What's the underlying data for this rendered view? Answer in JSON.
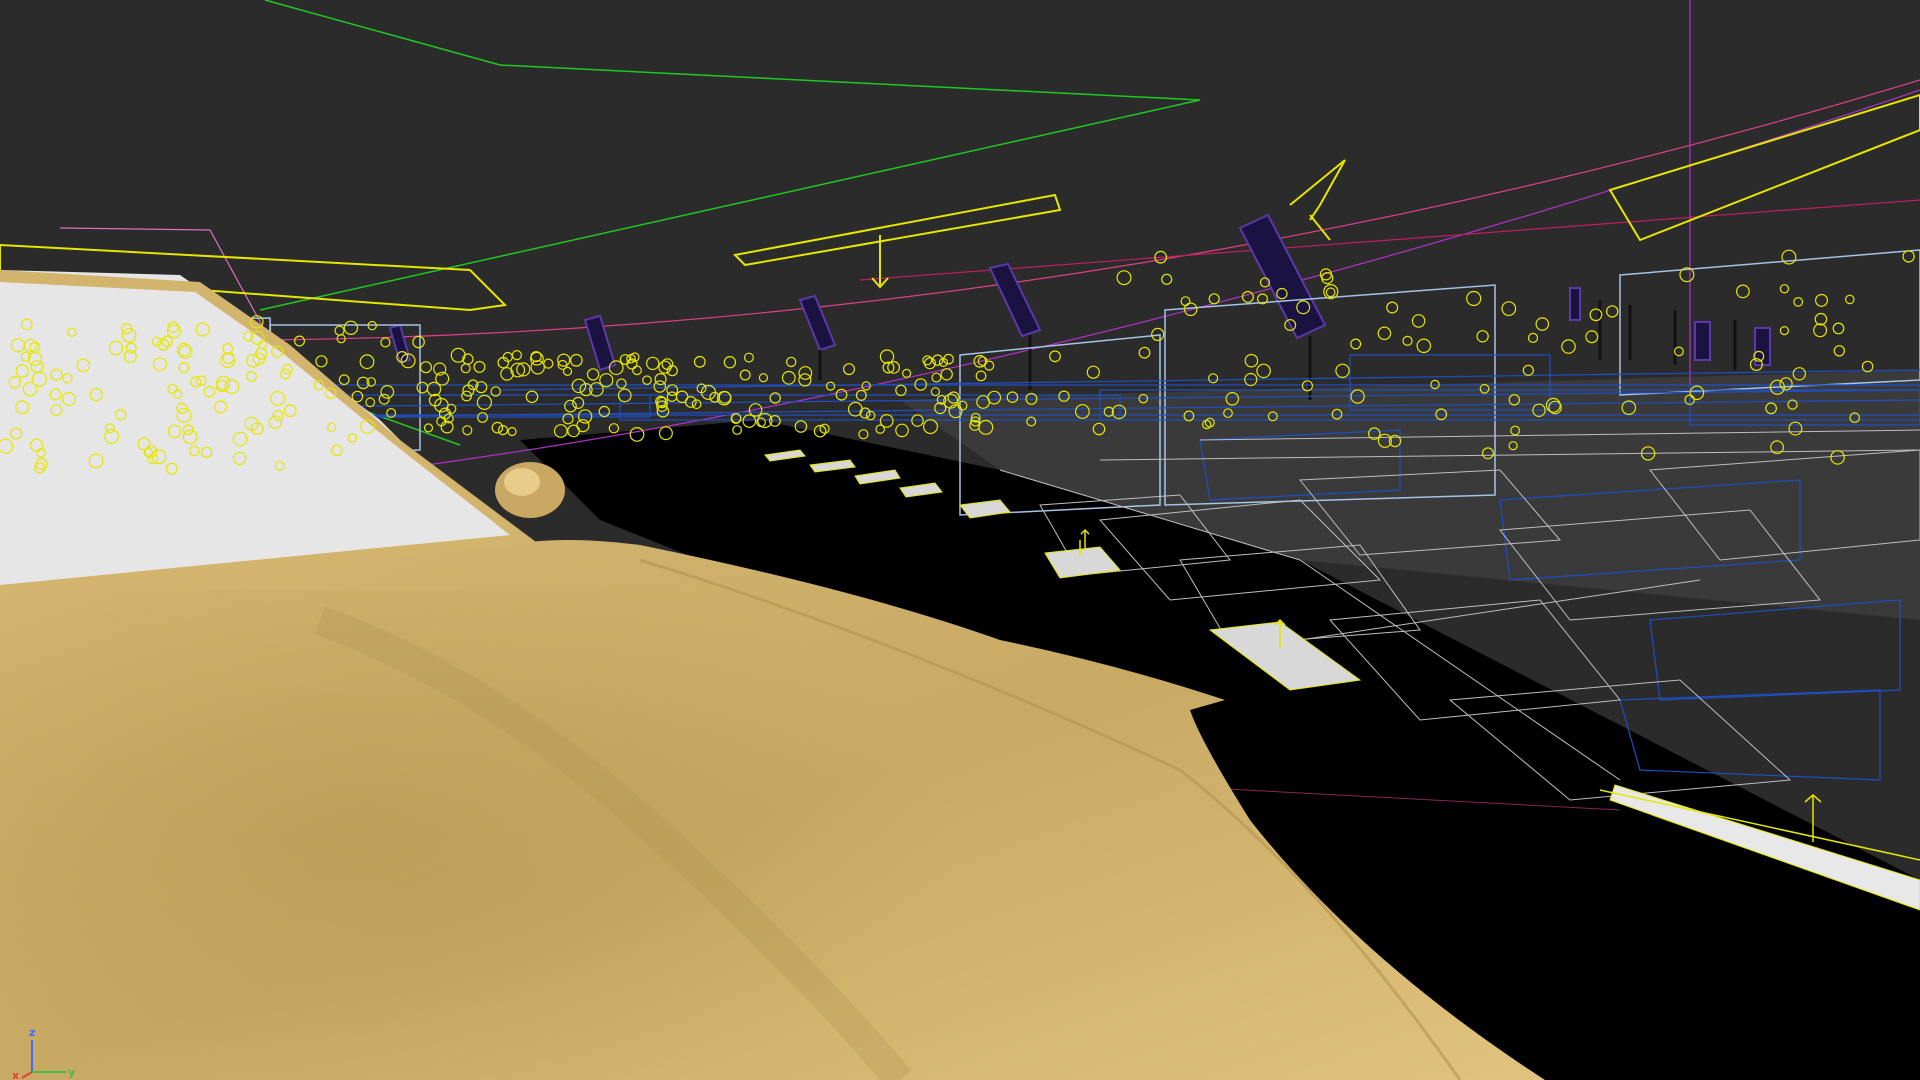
{
  "viewport": {
    "view_type": "3D perspective viewport",
    "background_color": "#2b2b2b",
    "ground_color": "#000000",
    "grid_shading_color": "#3c3c3c"
  },
  "scene": {
    "car_body_color": "#d2b46d",
    "car_highlight_color": "#e2c47e",
    "car_shadow_color": "#a98d4c",
    "windshield_color": "#e6e6e6",
    "light_helper_color": "#e6e600",
    "light_helper_count_estimate": 500,
    "light_helper_icon": "circle-light-icon",
    "blue_wireframe_color": "#1f4fc4",
    "light_blue_wireframe_color": "#a6c3e8",
    "white_wireframe_color": "#bfbfbf",
    "green_line_color": "#22c822",
    "magenta_line_color": "#b033c8",
    "pink_line_color": "#e0408a",
    "billboard_color": "#1a1240",
    "billboard_edge_color": "#5a3aa8",
    "curb_color": "#d8d8d8"
  },
  "axis_gizmo": {
    "z_label": "z",
    "x_label": "x",
    "y_label": "y",
    "z_color": "#3a6bff",
    "x_color": "#e04040",
    "y_color": "#40c040"
  }
}
